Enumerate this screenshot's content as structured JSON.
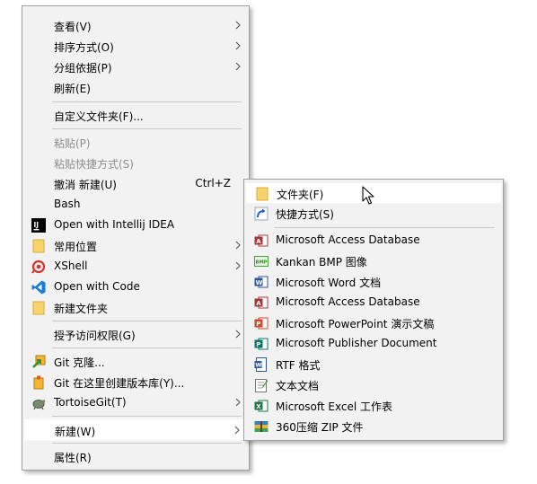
{
  "context_menu": {
    "items": [
      {
        "label": "查看(V)",
        "icon": "",
        "arrow": true
      },
      {
        "label": "排序方式(O)",
        "icon": "",
        "arrow": true
      },
      {
        "label": "分组依据(P)",
        "icon": "",
        "arrow": true
      },
      {
        "label": "刷新(E)",
        "icon": ""
      },
      {
        "label": "自定义文件夹(F)...",
        "icon": ""
      },
      {
        "label": "粘贴(P)",
        "icon": "",
        "disabled": true
      },
      {
        "label": "粘贴快捷方式(S)",
        "icon": "",
        "disabled": true
      },
      {
        "label": "撤消 新建(U)",
        "shortcut": "Ctrl+Z",
        "icon": ""
      },
      {
        "label": "Bash",
        "icon": ""
      },
      {
        "label": "Open with Intellij IDEA",
        "icon": "intellij-icon"
      },
      {
        "label": "常用位置",
        "icon": "folder-icon",
        "arrow": true
      },
      {
        "label": "XShell",
        "icon": "xshell-icon",
        "arrow": true
      },
      {
        "label": "Open with Code",
        "icon": "vscode-icon"
      },
      {
        "label": "新建文件夹",
        "icon": "folder-icon"
      },
      {
        "label": "授予访问权限(G)",
        "icon": "",
        "arrow": true
      },
      {
        "label": "Git 克隆...",
        "icon": "git-clone-icon"
      },
      {
        "label": "Git 在这里创建版本库(Y)...",
        "icon": "git-create-repo-icon"
      },
      {
        "label": "TortoiseGit(T)",
        "icon": "tortoisegit-icon",
        "arrow": true
      },
      {
        "label": "新建(W)",
        "icon": "",
        "arrow": true,
        "hovered": true
      },
      {
        "label": "属性(R)",
        "icon": ""
      }
    ]
  },
  "new_submenu": {
    "items": [
      {
        "label": "文件夹(F)",
        "icon": "folder-icon",
        "hovered": true
      },
      {
        "label": "快捷方式(S)",
        "icon": "shortcut-icon"
      },
      {
        "label": "Microsoft Access Database",
        "icon": "access-icon"
      },
      {
        "label": "Kankan BMP 图像",
        "icon": "bmp-image-icon"
      },
      {
        "label": "Microsoft Word 文档",
        "icon": "word-icon"
      },
      {
        "label": "Microsoft Access Database",
        "icon": "access-icon"
      },
      {
        "label": "Microsoft PowerPoint 演示文稿",
        "icon": "powerpoint-icon"
      },
      {
        "label": "Microsoft Publisher Document",
        "icon": "publisher-icon"
      },
      {
        "label": "RTF 格式",
        "icon": "rtf-document-icon"
      },
      {
        "label": "文本文档",
        "icon": "text-document-icon"
      },
      {
        "label": "Microsoft Excel 工作表",
        "icon": "excel-icon"
      },
      {
        "label": "360压缩 ZIP 文件",
        "icon": "zip-archive-icon"
      }
    ]
  },
  "colors": {
    "menu_background": "#f2f2f2",
    "hover_background": "#ffffff",
    "separator": "#c8c8c8",
    "disabled_text": "#8d8d8d",
    "folder_yellow": "#f6d36b"
  }
}
